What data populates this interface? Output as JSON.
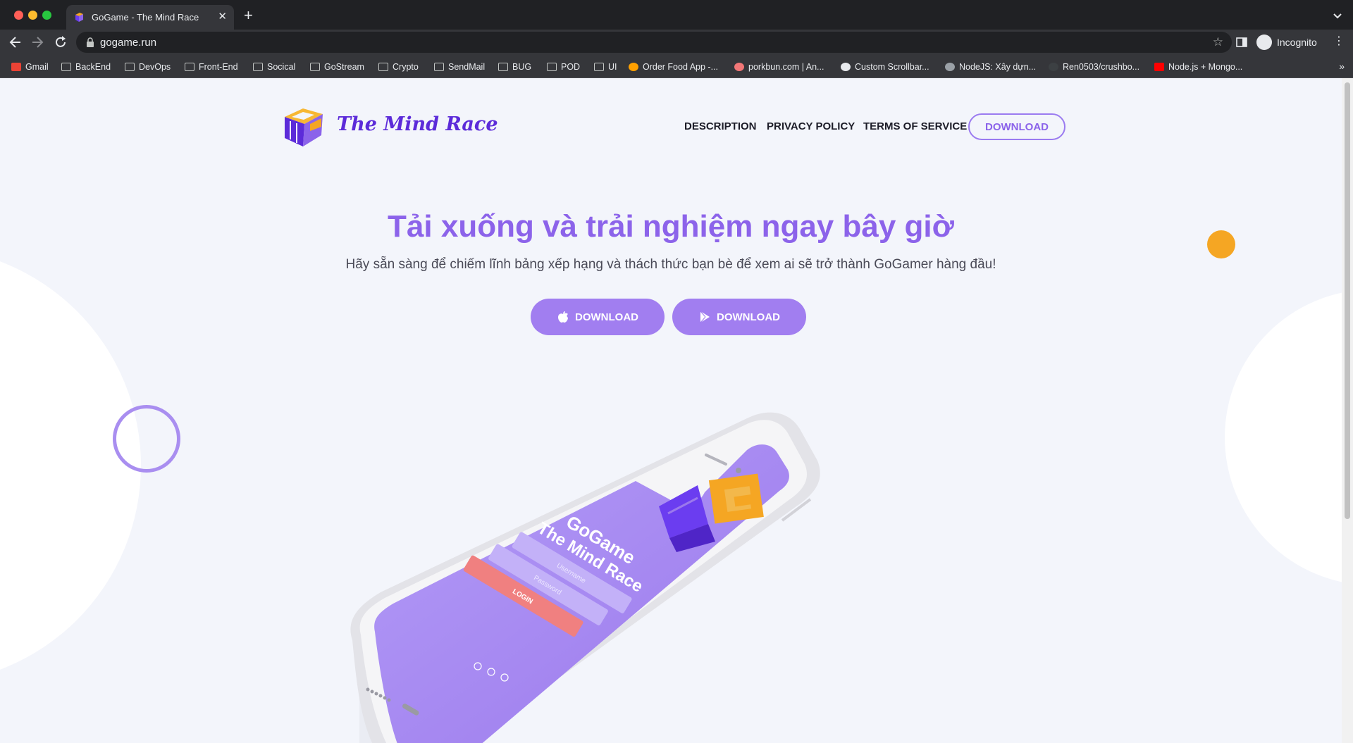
{
  "browser": {
    "tab_title": "GoGame - The Mind Race",
    "new_tab_symbol": "+",
    "close_symbol": "✕",
    "url": "gogame.run",
    "star_symbol": "☆",
    "profile_label": "Incognito",
    "menu_symbol": "⋮",
    "bookmarks_overflow": "»",
    "bookmarks": [
      {
        "label": "Gmail",
        "icon": "gmail-icon"
      },
      {
        "label": "BackEnd",
        "icon": "folder-icon"
      },
      {
        "label": "DevOps",
        "icon": "folder-icon"
      },
      {
        "label": "Front-End",
        "icon": "folder-icon"
      },
      {
        "label": "Socical",
        "icon": "folder-icon"
      },
      {
        "label": "GoStream",
        "icon": "folder-icon"
      },
      {
        "label": "Crypto",
        "icon": "folder-icon"
      },
      {
        "label": "SendMail",
        "icon": "folder-icon"
      },
      {
        "label": "BUG",
        "icon": "folder-icon"
      },
      {
        "label": "POD",
        "icon": "folder-icon"
      },
      {
        "label": "UI",
        "icon": "folder-icon"
      },
      {
        "label": "Order Food App -...",
        "icon": "firebase-icon"
      },
      {
        "label": "porkbun.com | An...",
        "icon": "porkbun-icon"
      },
      {
        "label": "Custom Scrollbar...",
        "icon": "codepen-icon"
      },
      {
        "label": "NodeJS: Xây dựn...",
        "icon": "globe-icon"
      },
      {
        "label": "Ren0503/crushbo...",
        "icon": "github-icon"
      },
      {
        "label": "Node.js + Mongo...",
        "icon": "youtube-icon"
      }
    ]
  },
  "site": {
    "brand": "The Mind Race",
    "nav": {
      "description": "DESCRIPTION",
      "privacy": "PRIVACY POLICY",
      "terms": "TERMS OF SERVICE",
      "download": "DOWNLOAD"
    },
    "hero": {
      "title": "Tải xuống và trải nghiệm ngay bây giờ",
      "subtitle": "Hãy sẵn sàng để chiếm lĩnh bảng xếp hạng và thách thức bạn bè để xem ai sẽ trở thành GoGamer hàng đầu!",
      "ios_button": "DOWNLOAD",
      "android_button": "DOWNLOAD"
    },
    "phone_screen": {
      "app_name_line1": "GoGame",
      "app_name_line2": "The Mind Race",
      "username_placeholder": "Username",
      "password_placeholder": "Password",
      "login_label": "LOGIN"
    }
  },
  "colors": {
    "accent": "#8c63ea",
    "button": "#a17ef0",
    "brand_text": "#5c2bd9",
    "orange": "#f5a623",
    "login_red": "#f08080",
    "page_bg": "#f3f5fb"
  }
}
